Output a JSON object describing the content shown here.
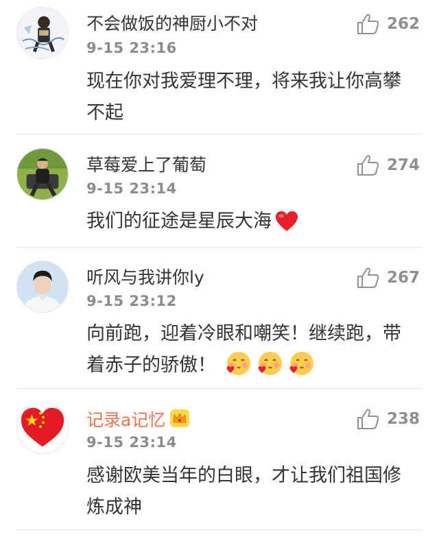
{
  "comments": [
    {
      "username": "不会做饭的神厨小不对",
      "time": "9-15 23:16",
      "likes": "262",
      "text": "现在你对我爱理不理，将来我让你高攀不起",
      "avatar_icon": "anime-figure-avatar"
    },
    {
      "username": "草莓爱上了葡萄",
      "time": "9-15 23:14",
      "likes": "274",
      "text": "我们的征途是星辰大海",
      "text_emoji": "red-heart-icon",
      "avatar_icon": "person-on-grass-avatar"
    },
    {
      "username": "听风与我讲你ly",
      "time": "9-15 23:12",
      "likes": "267",
      "text": "向前跑，迎着冷眼和嘲笑！继续跑，带着赤子的骄傲！",
      "text_emoji": "blushing-heart-face-icon",
      "avatar_icon": "young-man-portrait-avatar"
    },
    {
      "username": "记录a记忆",
      "username_color": "#eb7350",
      "badge_icon": "crown-badge-icon",
      "time": "9-15 23:14",
      "likes": "238",
      "text": "感谢欧美当年的白眼，才让我们祖国修炼成神",
      "avatar_icon": "china-flag-heart-avatar"
    }
  ],
  "colors": {
    "username": "#333333",
    "vip_username": "#eb7350",
    "meta": "#8c8c8c",
    "divider": "#e8e8e8"
  }
}
